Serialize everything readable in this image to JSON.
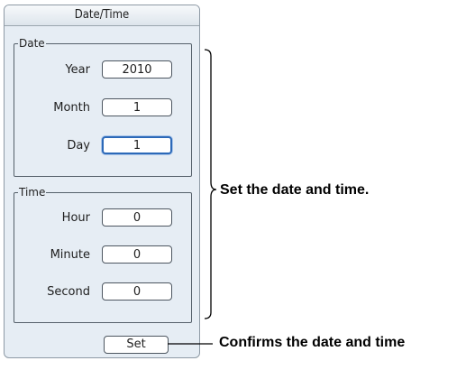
{
  "dialog": {
    "title": "Date/Time",
    "set_label": "Set"
  },
  "date_group": {
    "label": "Date",
    "fields": [
      {
        "label": "Year",
        "value": "2010",
        "focused": false
      },
      {
        "label": "Month",
        "value": "1",
        "focused": false
      },
      {
        "label": "Day",
        "value": "1",
        "focused": true
      }
    ]
  },
  "time_group": {
    "label": "Time",
    "fields": [
      {
        "label": "Hour",
        "value": "0"
      },
      {
        "label": "Minute",
        "value": "0"
      },
      {
        "label": "Second",
        "value": "0"
      }
    ]
  },
  "annotations": {
    "range_note": "Set the date and time.",
    "set_note": "Confirms the date and time"
  }
}
